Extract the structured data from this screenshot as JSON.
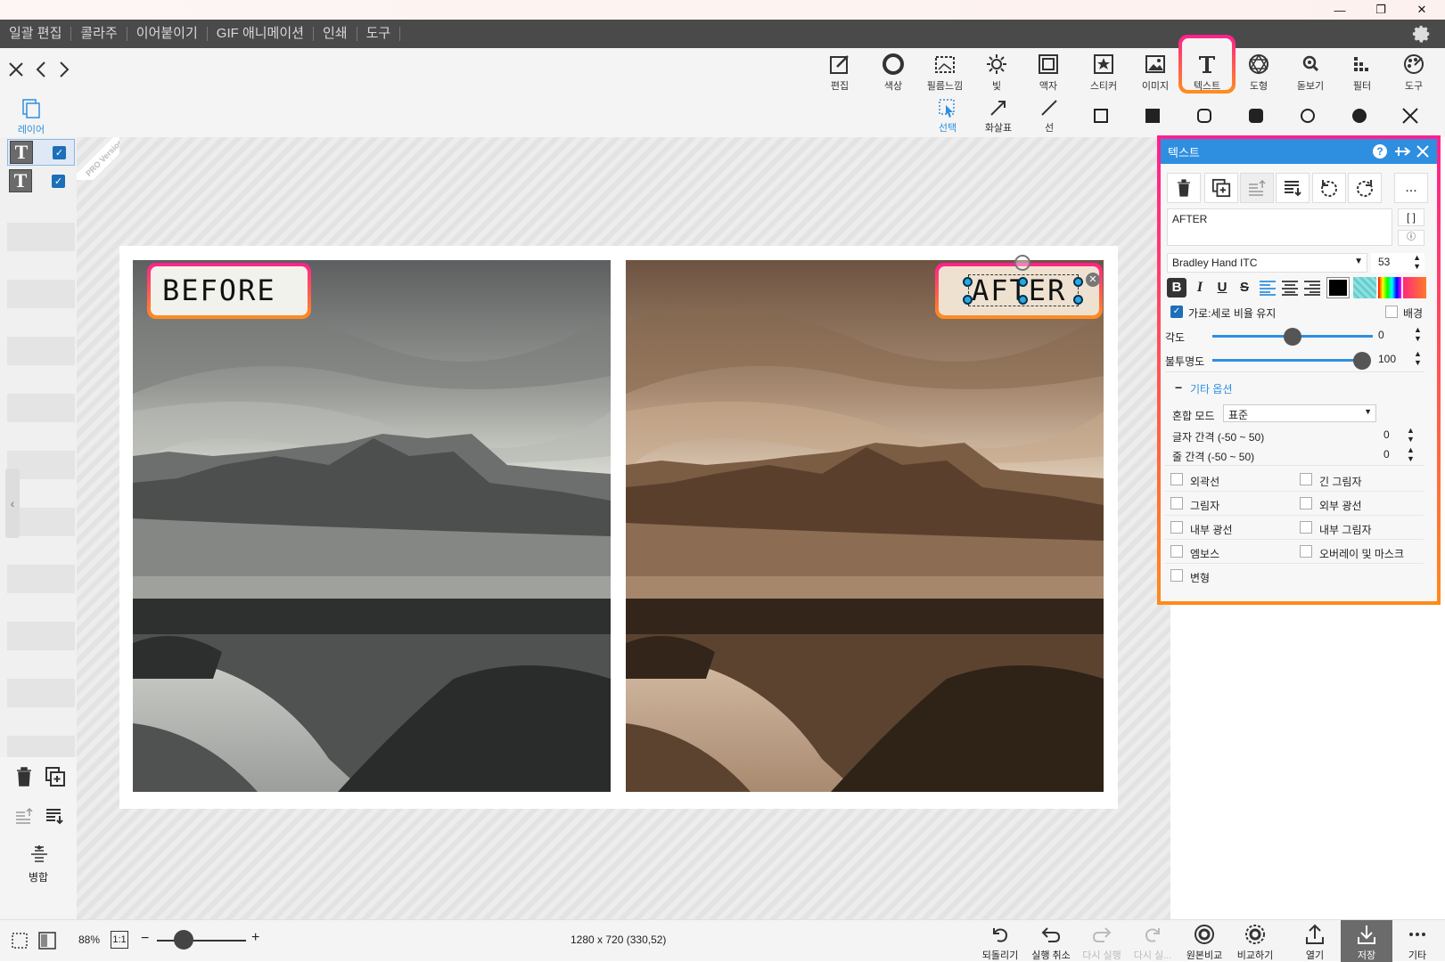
{
  "window": {
    "minimize": "—",
    "restore": "❐",
    "close": "✕"
  },
  "menu": [
    "일괄 편집",
    "콜라주",
    "이어붙이기",
    "GIF 애니메이션",
    "인쇄",
    "도구"
  ],
  "toolbar": [
    "편집",
    "색상",
    "필름느낌",
    "빛",
    "액자",
    "스티커",
    "이미지",
    "텍스트",
    "도형",
    "돋보기",
    "필터",
    "도구"
  ],
  "subtools": {
    "layer": "레이어",
    "select": "선택",
    "arrow": "화살표",
    "line": "선"
  },
  "layers": [
    {
      "icon": "T",
      "checked": true
    },
    {
      "icon": "T",
      "checked": true
    }
  ],
  "left_bottom": {
    "merge": "병합"
  },
  "pro_badge": "PRO Version",
  "canvas": {
    "before_text": "BEFORE",
    "after_text": "AFTER"
  },
  "text_panel": {
    "title": "텍스트",
    "text_value": "AFTER",
    "more": "...",
    "bracket": "[ ]",
    "font": "Bradley Hand ITC",
    "size": "53",
    "keep_ratio": "가로:세로 비율 유지",
    "background": "배경",
    "angle_label": "각도",
    "angle_value": "0",
    "angle_level": 0.5,
    "opacity_label": "불투명도",
    "opacity_value": "100",
    "opacity_level": 1.0,
    "other_options": "기타 옵션",
    "blend_label": "혼합 모드",
    "blend_value": "표준",
    "letter_spacing_label": "글자 간격 (-50 ~ 50)",
    "letter_spacing_value": "0",
    "line_spacing_label": "줄 간격 (-50 ~ 50)",
    "line_spacing_value": "0",
    "effects_left": [
      "외곽선",
      "그림자",
      "내부 광선",
      "엠보스",
      "변형"
    ],
    "effects_right": [
      "긴 그림자",
      "외부 광선",
      "내부 그림자",
      "오버레이 및 마스크"
    ],
    "help_icon": "?"
  },
  "status": {
    "zoom": "88%",
    "one_to_one": "1:1",
    "zoom_level": 0.3,
    "dimensions": "1280 x 720 (330,52)",
    "buttons": [
      "되돌리기",
      "실행 취소",
      "다시 실행",
      "다시 실...",
      "원본비교",
      "비교하기",
      "열기",
      "저장",
      "기타"
    ]
  },
  "colors": {
    "accent": "#2e8fe0",
    "highlight_top": "#ff1f8e",
    "highlight_bottom": "#ff8f1e",
    "menubar": "#4a4a4a"
  }
}
